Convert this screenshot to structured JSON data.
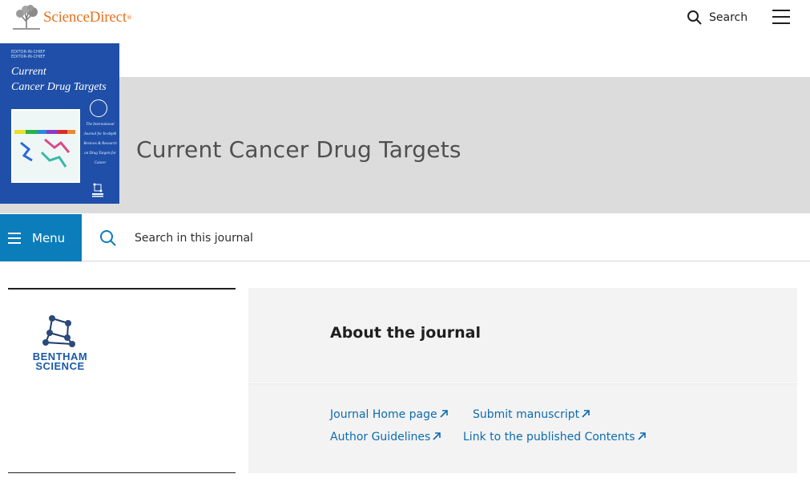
{
  "header": {
    "logo_text": "ScienceDirect",
    "search_label": "Search"
  },
  "journal": {
    "title": "Current Cancer Drug Targets",
    "cover": {
      "title_line1": "Current",
      "title_line2": "Cancer Drug Targets",
      "editor_lines": [
        "EDITOR-IN-CHIEF",
        "EDITOR-IN-CHIEF"
      ],
      "description": "The International Journal for In-depth Reviews & Research on Drug Targets for Cancer",
      "publisher": "BENTHAM SCIENCE"
    }
  },
  "menubar": {
    "menu_label": "Menu",
    "search_placeholder": "Search in this journal"
  },
  "publisher_logo": {
    "line1": "BENTHAM",
    "line2": "SCIENCE"
  },
  "about": {
    "title": "About the journal",
    "links": [
      {
        "label": "Journal Home page"
      },
      {
        "label": "Submit manuscript"
      },
      {
        "label": "Author Guidelines"
      },
      {
        "label": "Link to the published Contents"
      }
    ]
  },
  "colors": {
    "accent_blue": "#0c7dbb",
    "link_blue": "#0c6cb0",
    "brand_orange": "#e9711c",
    "band_gray": "#dcdcdc",
    "panel_gray": "#f3f3f3"
  }
}
